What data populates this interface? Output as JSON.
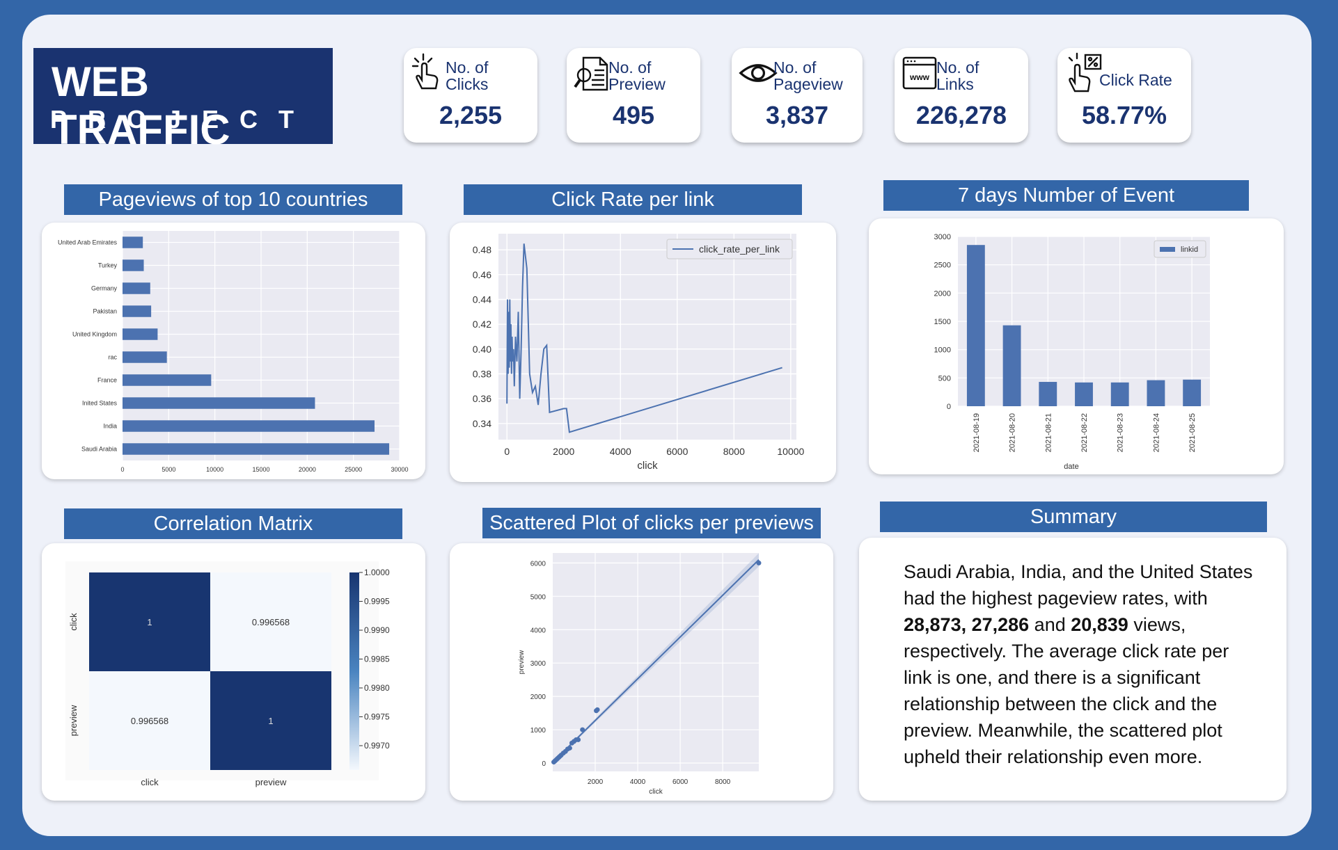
{
  "header": {
    "title": "WEB TRAFFIC",
    "subtitle": "PROJECT"
  },
  "kpis": [
    {
      "icon": "pointer-click-icon",
      "label_line1": "No. of",
      "label_line2": "Clicks",
      "value": "2,255"
    },
    {
      "icon": "document-search-icon",
      "label_line1": "No. of",
      "label_line2": "Preview",
      "value": "495"
    },
    {
      "icon": "eye-icon",
      "label_line1": "No. of",
      "label_line2": "Pageview",
      "value": "3,837"
    },
    {
      "icon": "www-browser-icon",
      "label_line1": "No. of",
      "label_line2": "Links",
      "value": "226,278"
    },
    {
      "icon": "percent-click-icon",
      "label_line1": "Click Rate",
      "label_line2": "",
      "value": "58.77%"
    }
  ],
  "panels": {
    "pageviews_title": "Pageviews of top 10 countries",
    "clickrate_title": "Click Rate per link",
    "events_title": "7 days Number of Event",
    "corr_title": "Correlation Matrix",
    "scatter_title": "Scattered Plot of clicks per previews",
    "summary_title": "Summary"
  },
  "summary": {
    "p1": "Saudi Arabia, India, and the United States had the highest pageview rates, with ",
    "b1": "28,873, 27,286",
    "p2": " and ",
    "b2": "20,839",
    "p3": " views, respectively. The average click rate per link is one, and there is a significant relationship between the click and the preview. Meanwhile, the scattered plot upheld their relationship even more."
  },
  "colors": {
    "accent": "#3366a8",
    "navy": "#1a3370",
    "bar": "#4c72b0",
    "plot_bg": "#eaeaf2"
  },
  "chart_data": [
    {
      "type": "bar",
      "orientation": "horizontal",
      "categories": [
        "United Arab Emirates",
        "Turkey",
        "Germany",
        "Pakistan",
        "United Kingdom",
        "rac",
        "France",
        "Inited States",
        "India",
        "Saudi Arabia"
      ],
      "values": [
        2200,
        2300,
        3000,
        3100,
        3800,
        4800,
        9600,
        20839,
        27286,
        28873
      ],
      "xticks": [
        "0",
        "5000",
        "10000",
        "15000",
        "20000",
        "25000",
        "30000"
      ],
      "xlim": [
        0,
        30000
      ],
      "grid": true
    },
    {
      "type": "line",
      "series": [
        {
          "name": "click_rate_per_link",
          "x": [
            0,
            20,
            40,
            60,
            80,
            100,
            120,
            140,
            160,
            180,
            200,
            230,
            260,
            300,
            350,
            400,
            450,
            500,
            550,
            600,
            700,
            800,
            900,
            1000,
            1100,
            1200,
            1300,
            1400,
            1500,
            2000,
            2100,
            2200,
            9700
          ],
          "y": [
            0.356,
            0.44,
            0.38,
            0.43,
            0.385,
            0.44,
            0.39,
            0.42,
            0.38,
            0.41,
            0.39,
            0.4,
            0.37,
            0.41,
            0.39,
            0.43,
            0.36,
            0.4,
            0.45,
            0.485,
            0.465,
            0.38,
            0.365,
            0.37,
            0.355,
            0.38,
            0.4,
            0.403,
            0.349,
            0.352,
            0.352,
            0.333,
            0.385
          ]
        }
      ],
      "xticks": [
        "0",
        "2000",
        "4000",
        "6000",
        "8000",
        "10000"
      ],
      "yticks": [
        "0.34",
        "0.36",
        "0.38",
        "0.40",
        "0.42",
        "0.44",
        "0.46",
        "0.48"
      ],
      "xlabel": "click",
      "xlim": [
        -300,
        10200
      ],
      "ylim": [
        0.327,
        0.493
      ],
      "legend": "top-right"
    },
    {
      "type": "bar",
      "categories": [
        "2021-08-19",
        "2021-08-20",
        "2021-08-21",
        "2021-08-22",
        "2021-08-23",
        "2021-08-24",
        "2021-08-25"
      ],
      "series": [
        {
          "name": "linkid",
          "values": [
            2850,
            1430,
            430,
            420,
            420,
            460,
            470
          ]
        }
      ],
      "yticks": [
        "0",
        "500",
        "1000",
        "1500",
        "2000",
        "2500",
        "3000"
      ],
      "ylim": [
        0,
        3000
      ],
      "xlabel": "date",
      "legend": "top-right"
    },
    {
      "type": "heatmap",
      "rows": [
        "click",
        "preview"
      ],
      "cols": [
        "click",
        "preview"
      ],
      "values": [
        [
          "1",
          "0.996568"
        ],
        [
          "0.996568",
          "1"
        ]
      ],
      "colorbar_ticks": [
        "1.0000",
        "0.9995",
        "0.9990",
        "0.9985",
        "0.9980",
        "0.9975",
        "0.9970"
      ]
    },
    {
      "type": "scatter",
      "x": [
        50,
        100,
        150,
        200,
        250,
        300,
        350,
        400,
        500,
        600,
        700,
        800,
        900,
        1000,
        1100,
        1200,
        1400,
        2050,
        2100,
        9700
      ],
      "y": [
        30,
        60,
        90,
        120,
        150,
        180,
        210,
        240,
        300,
        350,
        420,
        450,
        600,
        650,
        700,
        700,
        1000,
        1570,
        1600,
        6000
      ],
      "regression": true,
      "xticks": [
        "2000",
        "4000",
        "6000",
        "8000"
      ],
      "yticks": [
        "0",
        "1000",
        "2000",
        "3000",
        "4000",
        "5000",
        "6000"
      ],
      "xlabel": "click",
      "ylabel": "preview",
      "xlim": [
        0,
        9700
      ],
      "ylim": [
        -250,
        6300
      ]
    }
  ]
}
